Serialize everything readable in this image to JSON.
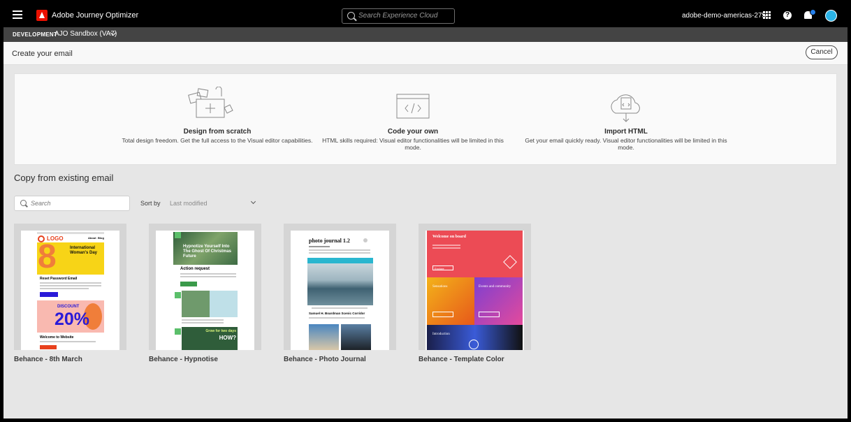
{
  "app": {
    "title": "Adobe Journey Optimizer",
    "search_placeholder": "Search Experience Cloud",
    "org_name": "adobe-demo-americas-275"
  },
  "env": {
    "label": "DEVELOPMENT",
    "sandbox": "AJO Sandbox (VA7)"
  },
  "header": {
    "title": "Create your email",
    "cancel_label": "Cancel"
  },
  "options": [
    {
      "title": "Design from scratch",
      "desc": "Total design freedom. Get the full access to the Visual editor capabilities."
    },
    {
      "title": "Code your own",
      "desc": "HTML skills required: Visual editor functionalities will be limited in this mode."
    },
    {
      "title": "Import HTML",
      "desc": "Get your email quickly ready. Visual editor functionalities will be limited in this mode."
    }
  ],
  "copy_section": {
    "title": "Copy from existing email",
    "search_placeholder": "Search",
    "sort_label": "Sort by",
    "sort_value": "Last modified"
  },
  "templates": [
    {
      "name": "Behance - 8th March",
      "logo": "LOGO",
      "headline": "International Woman's Day",
      "section": "Reset Password Email",
      "discount": "20%",
      "discount_label": "DISCOUNT",
      "footer": "Welcome to Website",
      "big": "8",
      "nav": [
        "About",
        "Blog"
      ]
    },
    {
      "name": "Behance - Hypnotise",
      "headline": "Hypnotize Yourself Into The Ghost Of Christmas Future",
      "section": "Action request",
      "promo": "Grow for two days",
      "promo2": "HOW?"
    },
    {
      "name": "Behance - Photo Journal",
      "headline": "photo journal 1.2",
      "caption": "Samuel H. Boardman Scenic Corridor"
    },
    {
      "name": "Behance - Template Color",
      "headline": "Welcome on board",
      "btn": "Explore",
      "col1": "Sensations",
      "col2": "Events and community",
      "footer": "Introduction"
    }
  ],
  "colors": {
    "topbar": "#000000",
    "envbar": "#444444",
    "adobe_red": "#eb1000",
    "accent_blue": "#2680eb"
  }
}
